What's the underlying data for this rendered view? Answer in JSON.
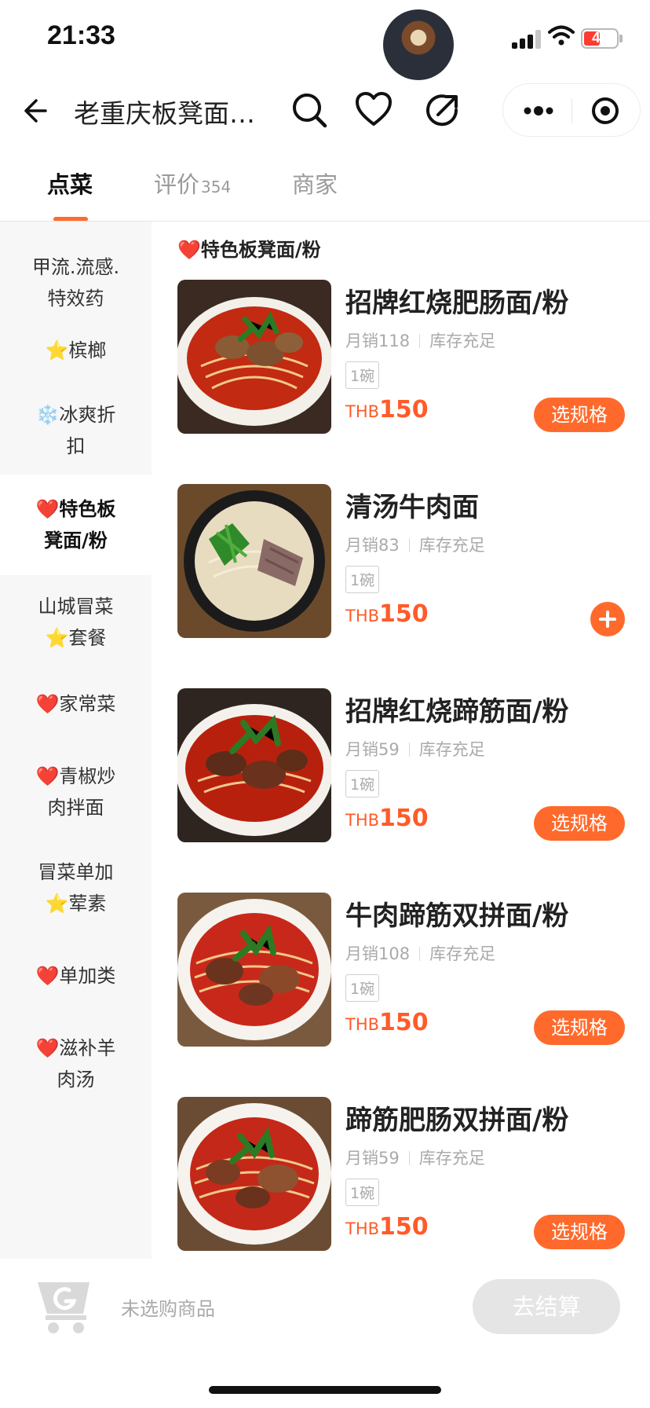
{
  "status_bar": {
    "time": "21:33",
    "battery": "47"
  },
  "nav": {
    "title": "老重庆板凳面…"
  },
  "tabs": [
    {
      "label": "点菜",
      "count": ""
    },
    {
      "label": "评价",
      "count": "354"
    },
    {
      "label": "商家",
      "count": ""
    }
  ],
  "sidebar": [
    {
      "line1": "甲流.流感.",
      "line2": "特效药"
    },
    {
      "line1": "⭐槟榔",
      "line2": ""
    },
    {
      "line1": "❄️冰爽折",
      "line2": "扣"
    },
    {
      "line1": "❤️特色板",
      "line2": "凳面/粉"
    },
    {
      "line1": "山城冒菜",
      "line2": "⭐套餐"
    },
    {
      "line1": "❤️家常菜",
      "line2": ""
    },
    {
      "line1": "❤️青椒炒",
      "line2": "肉拌面"
    },
    {
      "line1": "冒菜单加",
      "line2": "⭐荤素"
    },
    {
      "line1": "❤️单加类",
      "line2": ""
    },
    {
      "line1": "❤️滋补羊",
      "line2": "肉汤"
    }
  ],
  "section_title": "❤️特色板凳面/粉",
  "items": [
    {
      "name": "招牌红烧肥肠面/粉",
      "sales": "月销118",
      "stock": "库存充足",
      "spec": "1碗",
      "currency": "THB",
      "price": "150",
      "action": "选规格"
    },
    {
      "name": "清汤牛肉面",
      "sales": "月销83",
      "stock": "库存充足",
      "spec": "1碗",
      "currency": "THB",
      "price": "150",
      "action": ""
    },
    {
      "name": "招牌红烧蹄筋面/粉",
      "sales": "月销59",
      "stock": "库存充足",
      "spec": "1碗",
      "currency": "THB",
      "price": "150",
      "action": "选规格"
    },
    {
      "name": "牛肉蹄筋双拼面/粉",
      "sales": "月销108",
      "stock": "库存充足",
      "spec": "1碗",
      "currency": "THB",
      "price": "150",
      "action": "选规格"
    },
    {
      "name": "蹄筋肥肠双拼面/粉",
      "sales": "月销59",
      "stock": "库存充足",
      "spec": "1碗",
      "currency": "THB",
      "price": "150",
      "action": "选规格"
    }
  ],
  "bottom": {
    "cart_hint": "未选购商品",
    "checkout": "去结算"
  },
  "colors": {
    "accent": "#ff6a2c",
    "price": "#ff5b29"
  }
}
